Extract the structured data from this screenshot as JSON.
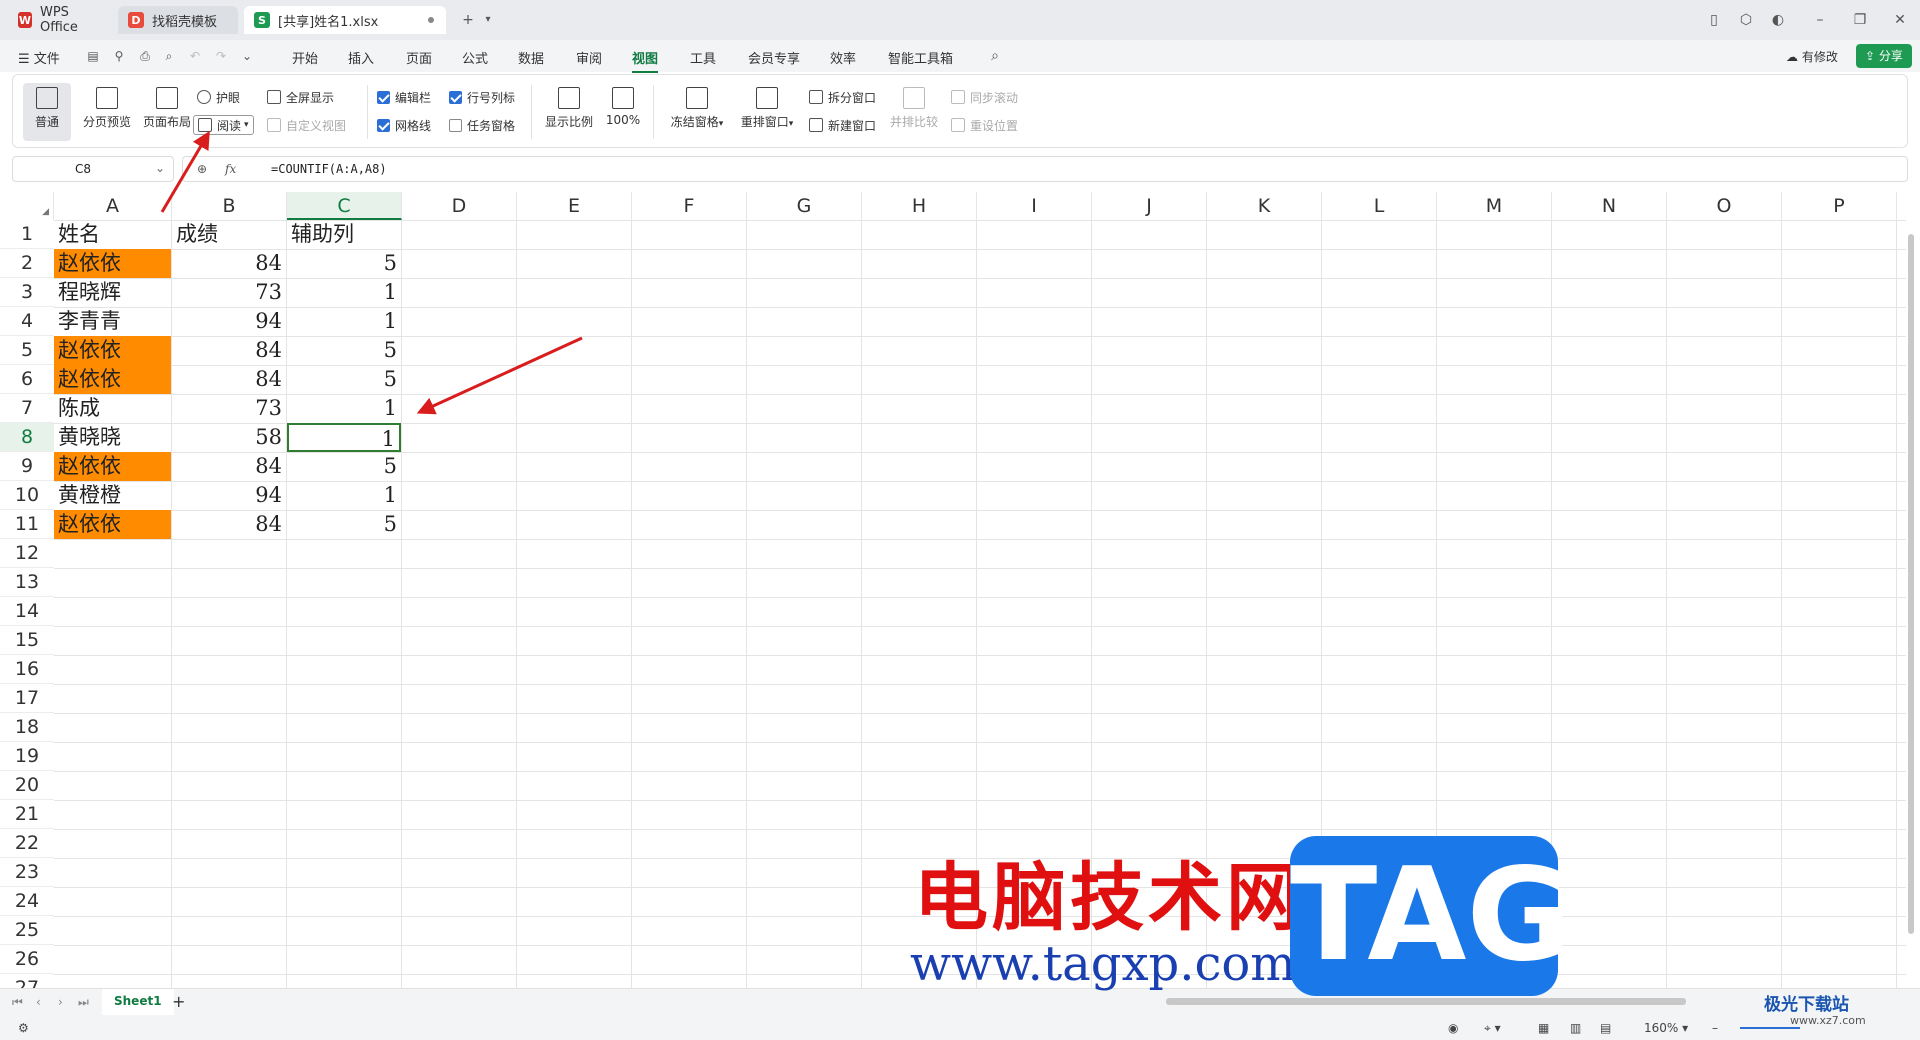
{
  "tabs": [
    {
      "label": "WPS Office",
      "icon": "wps-logo-icon",
      "color": "#d6302a"
    },
    {
      "label": "找稻壳模板",
      "icon": "docer-icon",
      "color": "#e84a3c"
    },
    {
      "label": "[共享]姓名1.xlsx",
      "icon": "spreadsheet-icon",
      "color": "#1f9a52"
    }
  ],
  "menu": {
    "file": "文件",
    "items": [
      "开始",
      "插入",
      "页面",
      "公式",
      "数据",
      "审阅",
      "视图",
      "工具",
      "会员专享",
      "效率",
      "智能工具箱"
    ],
    "active_index": 6,
    "changes_label": "有修改",
    "share_label": "分享"
  },
  "ribbon": {
    "normal": "普通",
    "page_break_preview": "分页预览",
    "page_layout": "页面布局",
    "eye_protect": "护眼",
    "reading": "阅读",
    "fullscreen": "全屏显示",
    "custom_view": "自定义视图",
    "formula_bar": "编辑栏",
    "row_col_headers": "行号列标",
    "gridlines": "网格线",
    "task_pane": "任务窗格",
    "zoom": "显示比例",
    "zoom_100": "100%",
    "freeze_panes": "冻结窗格",
    "arrange_all": "重排窗口",
    "split_window": "拆分窗口",
    "new_window": "新建窗口",
    "side_by_side": "并排比较",
    "sync_scroll": "同步滚动",
    "reset_position": "重设位置"
  },
  "formula_bar": {
    "name_box": "C8",
    "fx": "fx",
    "formula": "=COUNTIF(A:A,A8)"
  },
  "columns": [
    "A",
    "B",
    "C",
    "D",
    "E",
    "F",
    "G",
    "H",
    "I",
    "J",
    "K",
    "L",
    "M",
    "N",
    "O",
    "P"
  ],
  "selected_column": "C",
  "rows": [
    "1",
    "2",
    "3",
    "4",
    "5",
    "6",
    "7",
    "8",
    "9",
    "10",
    "11",
    "12",
    "13",
    "14",
    "15",
    "16",
    "17",
    "18",
    "19",
    "20",
    "21",
    "22",
    "23",
    "24",
    "25",
    "26",
    "27"
  ],
  "selected_row": "8",
  "sheet": {
    "header": [
      "姓名",
      "成绩",
      "辅助列"
    ],
    "data": [
      {
        "name": "赵依依",
        "score": "84",
        "helper": "5",
        "highlight": true
      },
      {
        "name": "程晓辉",
        "score": "73",
        "helper": "1",
        "highlight": false
      },
      {
        "name": "李青青",
        "score": "94",
        "helper": "1",
        "highlight": false
      },
      {
        "name": "赵依依",
        "score": "84",
        "helper": "5",
        "highlight": true
      },
      {
        "name": "赵依依",
        "score": "84",
        "helper": "5",
        "highlight": true
      },
      {
        "name": "陈成",
        "score": "73",
        "helper": "1",
        "highlight": false
      },
      {
        "name": "黄晓晓",
        "score": "58",
        "helper": "1",
        "highlight": false
      },
      {
        "name": "赵依依",
        "score": "84",
        "helper": "5",
        "highlight": true
      },
      {
        "name": "黄橙橙",
        "score": "94",
        "helper": "1",
        "highlight": false
      },
      {
        "name": "赵依依",
        "score": "84",
        "helper": "5",
        "highlight": true
      }
    ],
    "highlight_color": "#ff8c00"
  },
  "sheet_tabs": {
    "active": "Sheet1",
    "add": "+"
  },
  "status": {
    "zoom": "160%"
  },
  "watermark": {
    "title": "电脑技术网",
    "url": "www.tagxp.com",
    "tag": "TAG",
    "jg": "极光下载站",
    "jg_url": "www.xz7.com"
  }
}
